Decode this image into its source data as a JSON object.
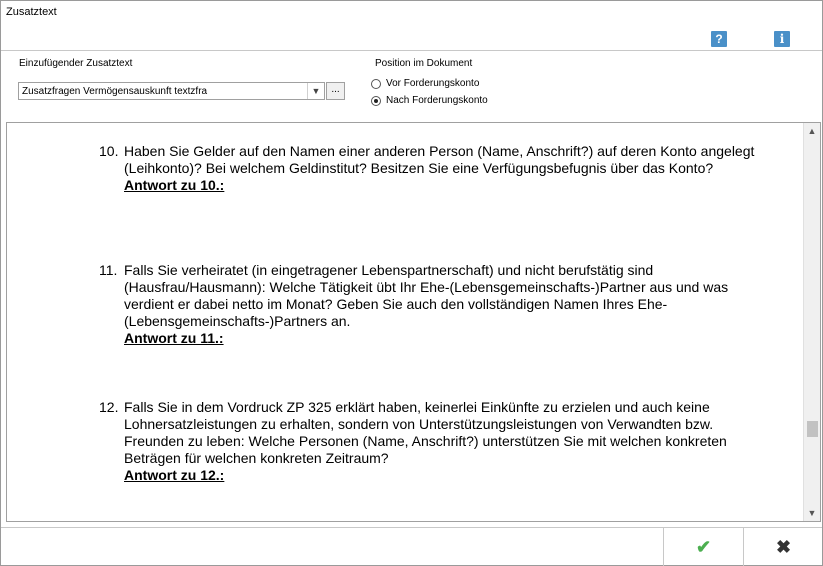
{
  "window": {
    "title": "Zusatztext"
  },
  "toolbar": {
    "help_glyph": "?",
    "info_glyph": "i"
  },
  "insert_text": {
    "label": "Einzufügender Zusatztext",
    "combo_value": "Zusatzfragen Vermögensauskunft   textzfra",
    "browse_label": "..."
  },
  "position": {
    "label": "Position im Dokument",
    "options": [
      {
        "label": "Vor Forderungskonto",
        "checked": false
      },
      {
        "label": "Nach Forderungskonto",
        "checked": true
      }
    ]
  },
  "questions": [
    {
      "number": "10.",
      "text": "Haben Sie Gelder auf den Namen einer anderen Person (Name, Anschrift?) auf deren Konto angelegt (Leihkonto)? Bei welchem Geldinstitut? Besitzen Sie eine Verfügungsbefugnis über das Konto?",
      "answer": "Antwort zu 10.:"
    },
    {
      "number": "11.",
      "text": "Falls Sie verheiratet (in eingetragener Lebenspartnerschaft) und nicht berufstätig sind (Hausfrau/Hausmann): Welche Tätigkeit übt Ihr Ehe-(Lebensgemeinschafts-)Partner aus und was verdient er dabei netto im Monat? Geben Sie auch den vollständigen Namen Ihres Ehe-(Lebensgemeinschafts-)Partners an.",
      "answer": "Antwort zu 11.:"
    },
    {
      "number": "12.",
      "text": "Falls Sie in dem Vordruck ZP 325 erklärt haben, keinerlei Einkünfte zu erzielen und auch keine Lohnersatzleistungen zu erhalten, sondern von Unterstützungsleistungen von Verwandten bzw. Freunden zu leben: Welche Personen (Name, Anschrift?) unterstützen Sie mit welchen konkreten Beträgen für welchen konkreten Zeitraum?",
      "answer": "Antwort zu 12.:"
    }
  ],
  "buttons": {
    "ok_glyph": "✔",
    "cancel_glyph": "✖"
  },
  "colors": {
    "ok": "#4caf50",
    "help_icon": "#4a90c8"
  }
}
